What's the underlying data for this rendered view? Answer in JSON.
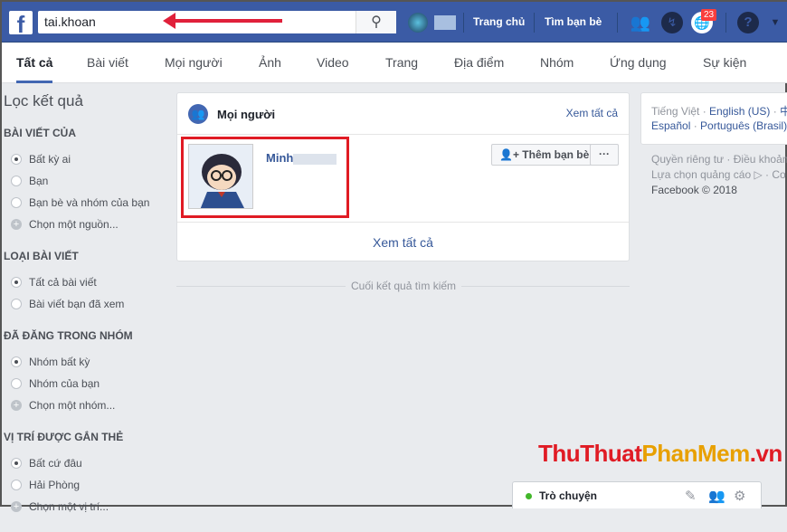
{
  "header": {
    "logo": "f",
    "search_value": "tai.khoan",
    "search_icon": "search-icon",
    "nav": [
      "Trang chủ",
      "Tìm bạn bè"
    ],
    "notification_count": "23",
    "help": "?"
  },
  "tabs": [
    "Tất cả",
    "Bài viết",
    "Mọi người",
    "Ảnh",
    "Video",
    "Trang",
    "Địa điểm",
    "Nhóm",
    "Ứng dụng",
    "Sự kiện"
  ],
  "filters": {
    "title": "Lọc kết quả",
    "groups": [
      {
        "heading": "BÀI VIẾT CỦA",
        "options": [
          "Bất kỳ ai",
          "Bạn",
          "Bạn bè và nhóm của bạn"
        ],
        "add": "Chọn một nguồn..."
      },
      {
        "heading": "LOẠI BÀI VIẾT",
        "options": [
          "Tất cả bài viết",
          "Bài viết bạn đã xem"
        ]
      },
      {
        "heading": "ĐÃ ĐĂNG TRONG NHÓM",
        "options": [
          "Nhóm bất kỳ",
          "Nhóm của bạn"
        ],
        "add": "Chọn một nhóm..."
      },
      {
        "heading": "VỊ TRÍ ĐƯỢC GẮN THẺ",
        "options": [
          "Bất cứ đâu",
          "Hải Phòng"
        ],
        "add": "Chọn một vị trí..."
      }
    ]
  },
  "people": {
    "title": "Mọi người",
    "see_all": "Xem tất cả",
    "person_name": "Minh",
    "add_friend": "Thêm bạn bè",
    "more": "···",
    "footer": "Xem tất cả"
  },
  "end_of_results": "Cuối kết quả tìm kiếm",
  "languages": {
    "current": "Tiếng Việt",
    "links": [
      "English (US)",
      "中",
      "Español",
      "Português (Brasil)"
    ]
  },
  "footer": {
    "line1": "Quyền riêng tư · Điều khoản",
    "line2": "Lựa chọn quảng cáo ▷ · Co",
    "copyright": "Facebook © 2018"
  },
  "chat": {
    "label": "Trò chuyện"
  },
  "watermark": {
    "part1": "ThuThuat",
    "part2": "PhanMem",
    "part3": ".vn"
  },
  "colors": {
    "brand": "#3b5ba5",
    "link": "#365899",
    "highlight": "#e01b24"
  }
}
